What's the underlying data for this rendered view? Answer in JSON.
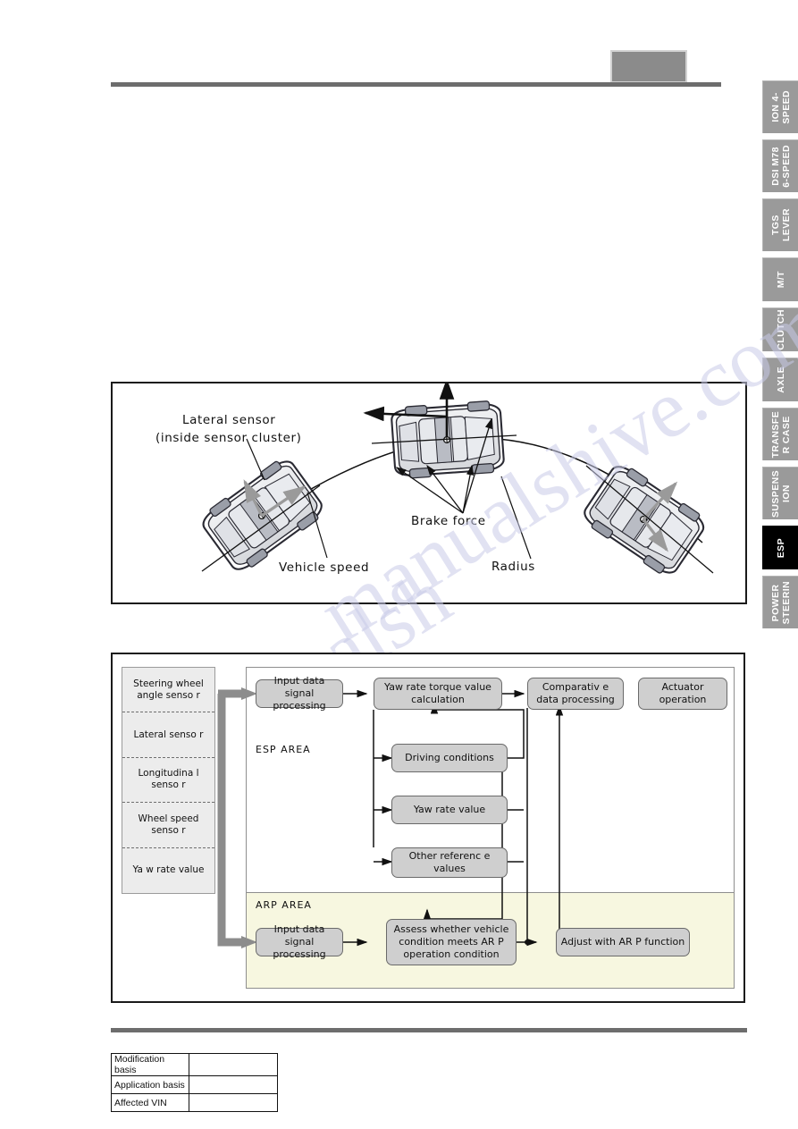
{
  "header": {
    "redacted_box": "",
    "rule": ""
  },
  "side_tabs": [
    {
      "label": "ION 4-\nSPEED",
      "active": false
    },
    {
      "label": "DSI M78\n6-SPEED",
      "active": false
    },
    {
      "label": "TGS\nLEVER",
      "active": false
    },
    {
      "label": "M/T",
      "active": false
    },
    {
      "label": "CLUTCH",
      "active": false
    },
    {
      "label": "AXLE",
      "active": false
    },
    {
      "label": "TRANSFE\nR CASE",
      "active": false
    },
    {
      "label": "SUSPENS\nION",
      "active": false
    },
    {
      "label": "ESP",
      "active": true
    },
    {
      "label": "POWER\nSTEERIN",
      "active": false
    }
  ],
  "figure": {
    "labels": {
      "lateral_sensor_line1": "Lateral  sensor",
      "lateral_sensor_line2": "(inside  sensor  cluster)",
      "vehicle_speed": "Vehicle  speed",
      "brake_force": "Brake  force",
      "radius": "Radius"
    }
  },
  "watermark": {
    "text_top": "manualshive.com",
    "text_bottom": "manualsh"
  },
  "flowchart": {
    "sensors": [
      "Steering  wheel\nangle  senso r",
      "Lateral  senso r",
      "Longitudina  l\nsenso r",
      "Wheel  speed\nsenso r",
      "Ya w rate  value"
    ],
    "esp_area_label": "ESP  AREA",
    "arp_area_label": "ARP  AREA",
    "esp_nodes": {
      "input": "Input data signal\nprocessing",
      "yaw_calc": "Yaw rate torque value\ncalculation",
      "comparative": "Comparativ e\ndata  processing",
      "actuator": "Actuator\noperation",
      "driving_conditions": "Driving  conditions",
      "yaw_rate_value": "Yaw rate value",
      "other_reference": "Other  referenc e\nvalues"
    },
    "arp_nodes": {
      "input": "Input data signal\nprocessing",
      "assess": "Assess   whether vehicle\ncondition meets  AR P\noperation  condition",
      "adjust": "Adjust with AR P  function"
    }
  },
  "footer": {
    "table_rows": [
      {
        "label": "Modification basis",
        "value": ""
      },
      {
        "label": "Application basis",
        "value": ""
      },
      {
        "label": "Affected VIN",
        "value": ""
      }
    ]
  },
  "colors": {
    "tab_inactive": "#9a9a9a",
    "tab_active": "#000000",
    "node_fill": "#cfcfcf",
    "arp_area_fill": "#f7f7e0",
    "sensor_fill": "#ececec",
    "rule": "#6d6d6d"
  }
}
